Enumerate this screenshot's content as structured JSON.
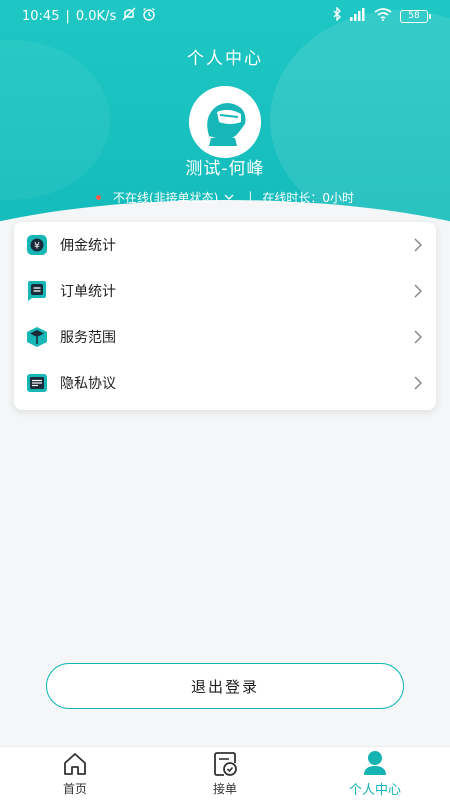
{
  "statusbar": {
    "time": "10:45",
    "network_speed": "0.0K/s",
    "battery": "58"
  },
  "header": {
    "title": "个人中心"
  },
  "profile": {
    "name": "测试-何峰",
    "status": "不在线(非接单状态)",
    "online_duration": "在线时长：0小时"
  },
  "menu": {
    "items": [
      {
        "label": "佣金统计",
        "icon": "yuan-coin-icon"
      },
      {
        "label": "订单统计",
        "icon": "order-chat-icon"
      },
      {
        "label": "服务范围",
        "icon": "package-box-icon"
      },
      {
        "label": "隐私协议",
        "icon": "document-icon"
      }
    ]
  },
  "logout": {
    "label": "退出登录"
  },
  "tabbar": {
    "tabs": [
      {
        "label": "首页",
        "icon": "home-icon"
      },
      {
        "label": "接单",
        "icon": "order-check-icon"
      },
      {
        "label": "个人中心",
        "icon": "person-icon",
        "active": true
      }
    ]
  },
  "colors": {
    "accent": "#16b7b6",
    "status_offline_dot": "#ff5a4d"
  }
}
